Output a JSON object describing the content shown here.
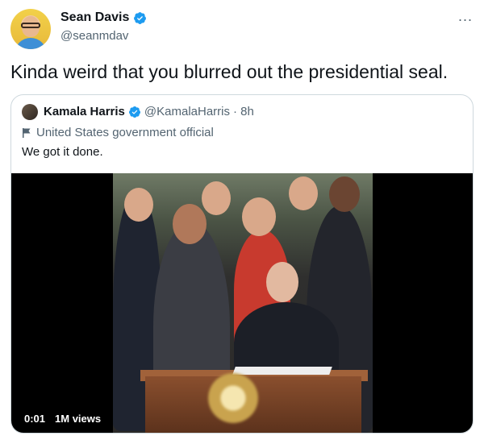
{
  "tweet": {
    "author_name": "Sean Davis",
    "author_handle": "@seanmdav",
    "more_icon": "...",
    "text": "Kinda weird that you blurred out the presidential seal."
  },
  "quoted": {
    "author_name": "Kamala Harris",
    "author_handle": "@KamalaHarris",
    "time": "· 8h",
    "label": "United States government official",
    "text": "We got it done.",
    "video": {
      "timestamp": "0:01",
      "views": "1M views"
    }
  },
  "colors": {
    "verified": "#1d9bf0",
    "secondary_text": "#536471",
    "border": "#cfd9de"
  }
}
